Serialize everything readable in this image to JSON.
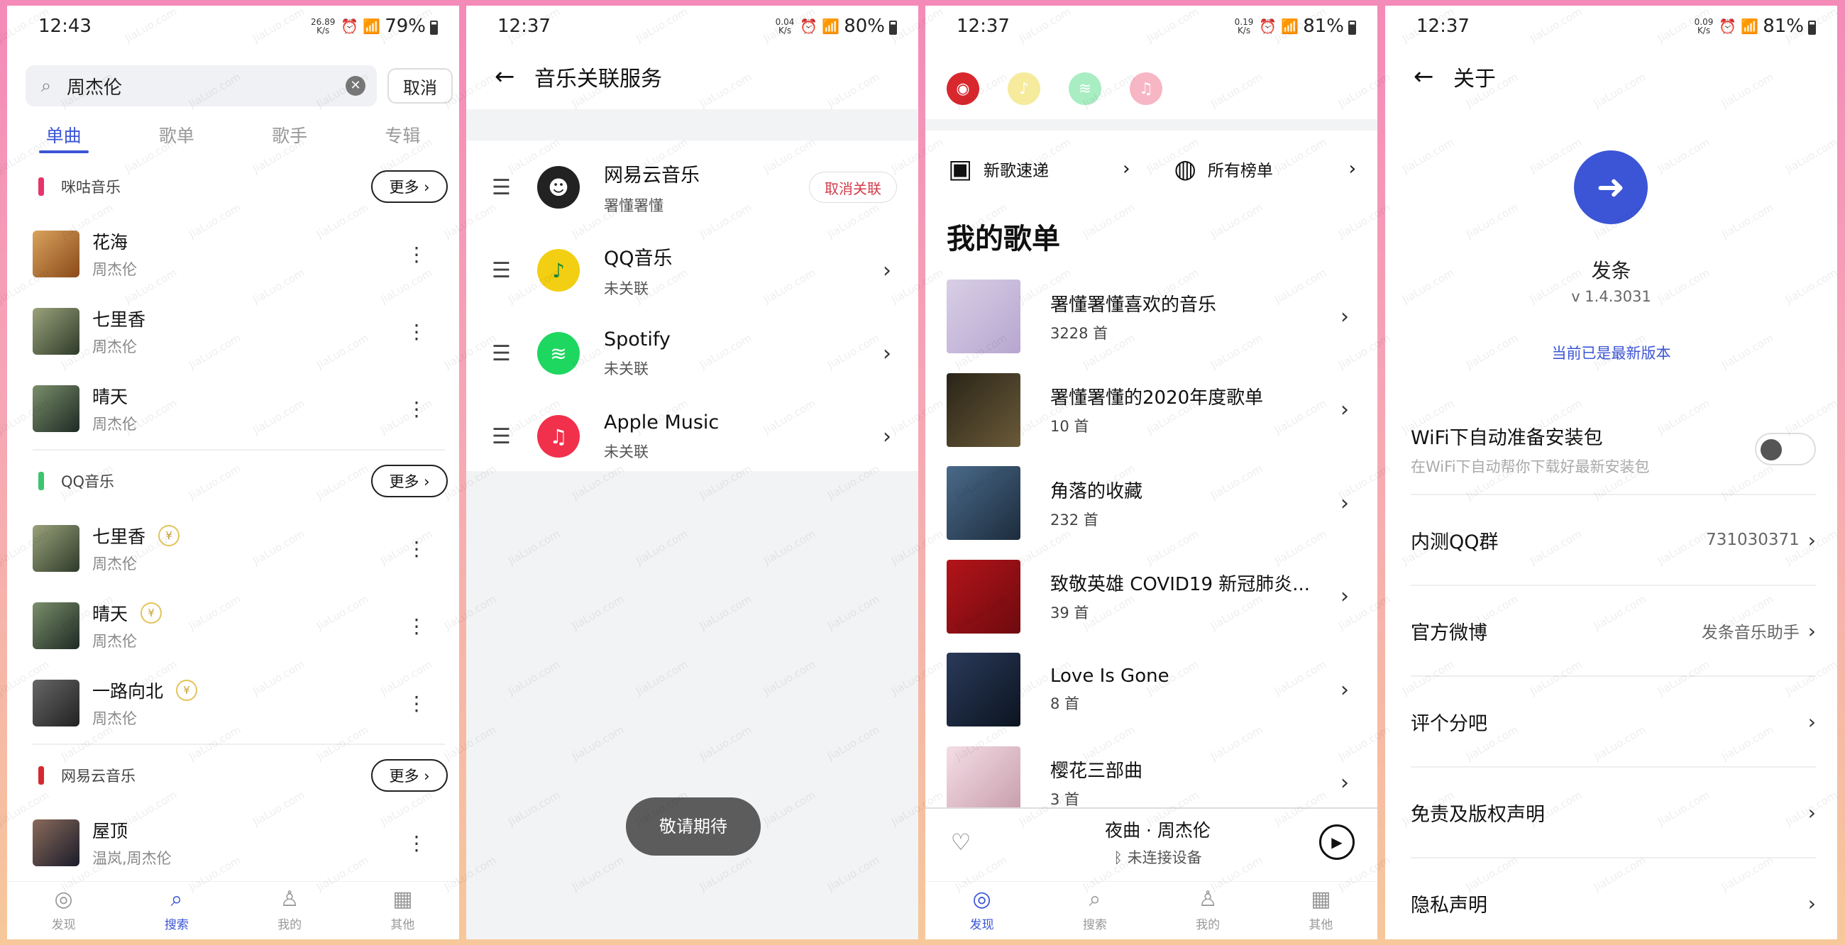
{
  "panel1": {
    "status": {
      "time": "12:43",
      "speed": "26.89\nK/s",
      "battery": "79%"
    },
    "search": {
      "value": "周杰伦",
      "cancel": "取消"
    },
    "tabs": [
      "单曲",
      "歌单",
      "歌手",
      "专辑"
    ],
    "more_label": "更多",
    "groups": [
      {
        "source": "咪咕音乐",
        "color": "#e8336b",
        "songs": [
          {
            "title": "花海",
            "artist": "周杰伦",
            "vip": false
          },
          {
            "title": "七里香",
            "artist": "周杰伦",
            "vip": false
          },
          {
            "title": "晴天",
            "artist": "周杰伦",
            "vip": false
          }
        ]
      },
      {
        "source": "QQ音乐",
        "color": "#3cc46e",
        "songs": [
          {
            "title": "七里香",
            "artist": "周杰伦",
            "vip": true
          },
          {
            "title": "晴天",
            "artist": "周杰伦",
            "vip": true
          },
          {
            "title": "一路向北",
            "artist": "周杰伦",
            "vip": true
          }
        ]
      },
      {
        "source": "网易云音乐",
        "color": "#d6282e",
        "songs": [
          {
            "title": "屋顶",
            "artist": "温岚,周杰伦",
            "vip": false
          }
        ]
      }
    ],
    "vip_glyph": "¥",
    "nav": [
      {
        "label": "发现",
        "icon": "compass-icon",
        "glyph": "◎"
      },
      {
        "label": "搜索",
        "icon": "search-icon",
        "glyph": "⌕"
      },
      {
        "label": "我的",
        "icon": "user-icon",
        "glyph": "♙"
      },
      {
        "label": "其他",
        "icon": "grid-icon",
        "glyph": "▦"
      }
    ]
  },
  "panel2": {
    "status": {
      "time": "12:37",
      "speed": "0.04\nK/s",
      "battery": "80%"
    },
    "title": "音乐关联服务",
    "services": [
      {
        "name": "网易云音乐",
        "sub": "署懂署懂",
        "action": "取消关联",
        "linked": true,
        "icon_color": "#222",
        "glyph": "☻"
      },
      {
        "name": "QQ音乐",
        "sub": "未关联",
        "linked": false,
        "icon_color": "#f2cf12",
        "glyph": "♪"
      },
      {
        "name": "Spotify",
        "sub": "未关联",
        "linked": false,
        "icon_color": "#1ed760",
        "glyph": "≋"
      },
      {
        "name": "Apple Music",
        "sub": "未关联",
        "linked": false,
        "icon_color": "#f1304c",
        "glyph": "♫"
      }
    ],
    "toast": "敬请期待"
  },
  "panel3": {
    "status": {
      "time": "12:37",
      "speed": "0.19\nK/s",
      "battery": "81%"
    },
    "sources": [
      {
        "icon": "netease-icon",
        "color": "#d8282e",
        "glyph": "◉"
      },
      {
        "icon": "qq-music-icon",
        "color": "#f6ea9c",
        "glyph": "♪"
      },
      {
        "icon": "spotify-icon",
        "color": "#a9edc3",
        "glyph": "≋"
      },
      {
        "icon": "apple-music-icon",
        "color": "#f7b6c4",
        "glyph": "♫"
      }
    ],
    "quick": [
      {
        "label": "新歌速递",
        "glyph": "▣"
      },
      {
        "label": "所有榜单",
        "glyph": "◍"
      }
    ],
    "section_title": "我的歌单",
    "playlists": [
      {
        "name": "署懂署懂喜欢的音乐",
        "count": "3228 首"
      },
      {
        "name": "署懂署懂的2020年度歌单",
        "count": "10 首"
      },
      {
        "name": "角落的收藏",
        "count": "232 首"
      },
      {
        "name": "致敬英雄 COVID19 新冠肺炎...",
        "count": "39 首"
      },
      {
        "name": "Love Is Gone",
        "count": "8 首"
      },
      {
        "name": "樱花三部曲",
        "count": "3 首"
      }
    ],
    "player": {
      "title": "夜曲 · 周杰伦",
      "device": "未连接设备"
    },
    "nav": [
      {
        "label": "发现",
        "icon": "compass-icon",
        "glyph": "◎"
      },
      {
        "label": "搜索",
        "icon": "search-icon",
        "glyph": "⌕"
      },
      {
        "label": "我的",
        "icon": "user-icon",
        "glyph": "♙"
      },
      {
        "label": "其他",
        "icon": "grid-icon",
        "glyph": "▦"
      }
    ]
  },
  "panel4": {
    "status": {
      "time": "12:37",
      "speed": "0.09\nK/s",
      "battery": "81%"
    },
    "title": "关于",
    "app_name": "发条",
    "version": "v 1.4.3031",
    "latest": "当前已是最新版本",
    "wifi": {
      "label": "WiFi下自动准备安装包",
      "sub": "在WiFi下自动帮你下载好最新安装包",
      "on": false
    },
    "rows": [
      {
        "label": "内测QQ群",
        "value": "731030371"
      },
      {
        "label": "官方微博",
        "value": "发条音乐助手"
      },
      {
        "label": "评个分吧",
        "value": ""
      },
      {
        "label": "免责及版权声明",
        "value": ""
      },
      {
        "label": "隐私声明",
        "value": ""
      }
    ]
  },
  "watermark": "JiaLuo.com"
}
